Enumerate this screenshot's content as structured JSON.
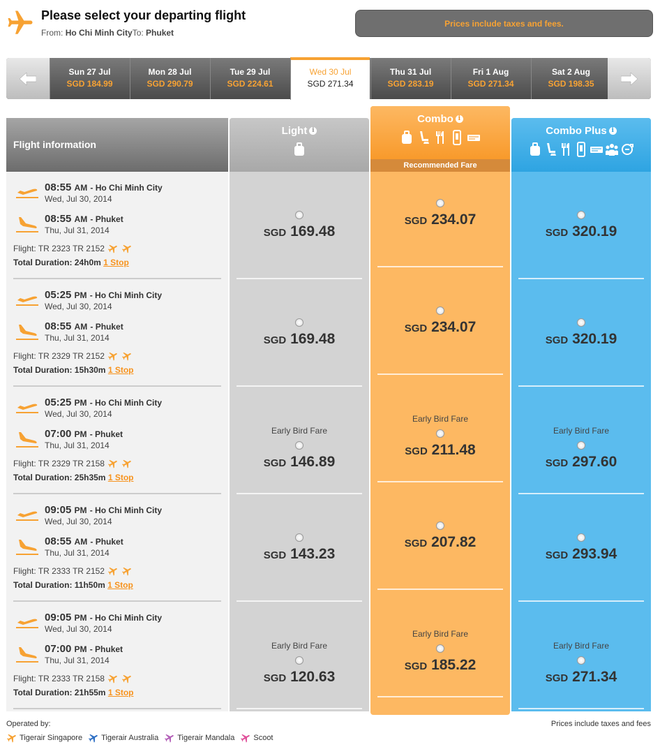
{
  "header": {
    "title": "Please select your departing flight",
    "from_label": "From:",
    "from": "Ho Chi Minh City",
    "to_label": "To:",
    "to": "Phuket",
    "tax_notice": "Prices include taxes and fees."
  },
  "dates": [
    {
      "label": "Sun 27 Jul",
      "price": "SGD 184.99"
    },
    {
      "label": "Mon 28 Jul",
      "price": "SGD 290.79"
    },
    {
      "label": "Tue 29 Jul",
      "price": "SGD 224.61"
    },
    {
      "label": "Wed 30 Jul",
      "price": "SGD 271.34",
      "selected": true
    },
    {
      "label": "Thu 31 Jul",
      "price": "SGD 283.19"
    },
    {
      "label": "Fri 1 Aug",
      "price": "SGD 271.34"
    },
    {
      "label": "Sat 2 Aug",
      "price": "SGD 198.35"
    }
  ],
  "columns": {
    "info": "Flight information",
    "light": "Light",
    "combo": "Combo",
    "combo_tag": "Recommended Fare",
    "plus": "Combo Plus"
  },
  "flights": [
    {
      "dep_time": "08:55",
      "dep_ampm": "AM",
      "dep_city": "- Ho Chi Minh City",
      "dep_date": "Wed, Jul 30, 2014",
      "arr_time": "08:55",
      "arr_ampm": "AM",
      "arr_city": "- Phuket",
      "arr_date": "Thu, Jul 31, 2014",
      "flight": "Flight: TR 2323 TR 2152",
      "duration": "Total Duration: 24h0m",
      "stops": "1 Stop",
      "early": "",
      "light": "169.48",
      "combo": "234.07",
      "plus": "320.19"
    },
    {
      "dep_time": "05:25",
      "dep_ampm": "PM",
      "dep_city": "- Ho Chi Minh City",
      "dep_date": "Wed, Jul 30, 2014",
      "arr_time": "08:55",
      "arr_ampm": "AM",
      "arr_city": "- Phuket",
      "arr_date": "Thu, Jul 31, 2014",
      "flight": "Flight: TR 2329 TR 2152",
      "duration": "Total Duration: 15h30m",
      "stops": "1 Stop",
      "early": "",
      "light": "169.48",
      "combo": "234.07",
      "plus": "320.19"
    },
    {
      "dep_time": "05:25",
      "dep_ampm": "PM",
      "dep_city": "- Ho Chi Minh City",
      "dep_date": "Wed, Jul 30, 2014",
      "arr_time": "07:00",
      "arr_ampm": "PM",
      "arr_city": "- Phuket",
      "arr_date": "Thu, Jul 31, 2014",
      "flight": "Flight: TR 2329 TR 2158",
      "duration": "Total Duration: 25h35m",
      "stops": "1 Stop",
      "early": "Early Bird Fare",
      "light": "146.89",
      "combo": "211.48",
      "plus": "297.60"
    },
    {
      "dep_time": "09:05",
      "dep_ampm": "PM",
      "dep_city": "- Ho Chi Minh City",
      "dep_date": "Wed, Jul 30, 2014",
      "arr_time": "08:55",
      "arr_ampm": "AM",
      "arr_city": "- Phuket",
      "arr_date": "Thu, Jul 31, 2014",
      "flight": "Flight: TR 2333 TR 2152",
      "duration": "Total Duration: 11h50m",
      "stops": "1 Stop",
      "early": "",
      "light": "143.23",
      "combo": "207.82",
      "plus": "293.94"
    },
    {
      "dep_time": "09:05",
      "dep_ampm": "PM",
      "dep_city": "- Ho Chi Minh City",
      "dep_date": "Wed, Jul 30, 2014",
      "arr_time": "07:00",
      "arr_ampm": "PM",
      "arr_city": "- Phuket",
      "arr_date": "Thu, Jul 31, 2014",
      "flight": "Flight: TR 2333 TR 2158",
      "duration": "Total Duration: 21h55m",
      "stops": "1 Stop",
      "early": "Early Bird Fare",
      "light": "120.63",
      "combo": "185.22",
      "plus": "271.34"
    }
  ],
  "currency": "SGD",
  "footer": {
    "operated_by": "Operated by:",
    "tax_note": "Prices include taxes and fees",
    "airlines": [
      {
        "name": "Tigerair Singapore",
        "color": "#f7a233"
      },
      {
        "name": "Tigerair Australia",
        "color": "#2e6fc4"
      },
      {
        "name": "Tigerair Mandala",
        "color": "#b35fb8"
      },
      {
        "name": "Scoot",
        "color": "#e0509a"
      }
    ]
  },
  "colors": {
    "accent": "#f7a233",
    "combo": "#fdb862",
    "plus": "#5bbcee",
    "light": "#d3d3d3"
  }
}
